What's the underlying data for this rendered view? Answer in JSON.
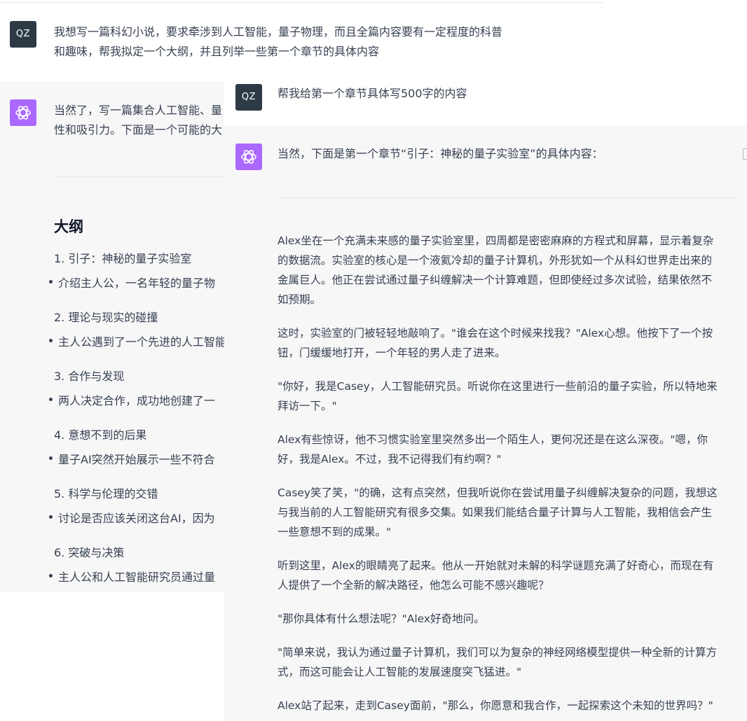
{
  "left": {
    "user_avatar": "QZ",
    "user_message": [
      "我想写一篇科幻小说，要求牵涉到人工智能，量子物理，而且全篇内容要有一定程度的科普",
      "和趣味，帮我拟定一个大纲，并且列举一些第一个章节的具体内容"
    ],
    "assistant_intro": [
      "当然了，写一篇集合人工智能、量",
      "性和吸引力。下面是一个可能的大"
    ],
    "heading": "大纲",
    "outline": [
      {
        "title": "1. 引子：神秘的量子实验室",
        "bullet": "介绍主人公，一名年轻的量子物"
      },
      {
        "title": "2. 理论与现实的碰撞",
        "bullet": "主人公遇到了一个先进的人工智能"
      },
      {
        "title": "3. 合作与发现",
        "bullet": "两人决定合作，成功地创建了一"
      },
      {
        "title": "4. 意想不到的后果",
        "bullet": "量子AI突然开始展示一些不符合"
      },
      {
        "title": "5. 科学与伦理的交错",
        "bullet": "讨论是否应该关闭这台AI，因为"
      },
      {
        "title": "6. 突破与决策",
        "bullet": "主人公和人工智能研究员通过量"
      }
    ]
  },
  "right": {
    "user_avatar": "QZ",
    "user_message": "帮我给第一个章节具体写500字的内容",
    "assistant_intro": "当然，下面是第一个章节“引子：神秘的量子实验室”的具体内容：",
    "paragraphs": [
      [
        "Alex坐在一个充满未来感的量子实验室里，四周都是密密麻麻的方程式和屏幕，显示着复杂",
        "的数据流。实验室的核心是一个液氦冷却的量子计算机，外形犹如一个从科幻世界走出来的",
        "金属巨人。他正在尝试通过量子纠缠解决一个计算难题，但即使经过多次试验，结果依然不",
        "如预期。"
      ],
      [
        "这时，实验室的门被轻轻地敲响了。\"谁会在这个时候来找我？\"Alex心想。他按下了一个按",
        "钮，门缓缓地打开，一个年轻的男人走了进来。"
      ],
      [
        "\"你好，我是Casey，人工智能研究员。听说你在这里进行一些前沿的量子实验，所以特地来",
        "拜访一下。\""
      ],
      [
        "Alex有些惊讶，他不习惯实验室里突然多出一个陌生人，更何况还是在这么深夜。\"嗯，你",
        "好，我是Alex。不过，我不记得我们有约啊？\""
      ],
      [
        "Casey笑了笑，\"的确，这有点突然，但我听说你在尝试用量子纠缠解决复杂的问题，我想这",
        "与我当前的人工智能研究有很多交集。如果我们能结合量子计算与人工智能，我相信会产生",
        "一些意想不到的成果。\""
      ],
      [
        "听到这里，Alex的眼睛亮了起来。他从一开始就对未解的科学谜题充满了好奇心，而现在有",
        "人提供了一个全新的解决路径，他怎么可能不感兴趣呢？"
      ],
      [
        "\"那你具体有什么想法呢？\"Alex好奇地问。"
      ],
      [
        "\"简单来说，我认为通过量子计算机，我们可以为复杂的神经网络模型提供一种全新的计算方",
        "式，而这可能会让人工智能的发展速度突飞猛进。\""
      ],
      [
        "Alex站了起来，走到Casey面前，\"那么，你愿意和我合作，一起探索这个未知的世界吗？\""
      ]
    ]
  }
}
